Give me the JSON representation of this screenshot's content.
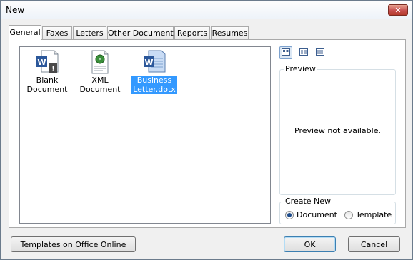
{
  "window": {
    "title": "New",
    "close_symbol": "✕"
  },
  "tabs": [
    {
      "label": "General",
      "active": true
    },
    {
      "label": "Faxes"
    },
    {
      "label": "Letters"
    },
    {
      "label": "Other Documents"
    },
    {
      "label": "Reports"
    },
    {
      "label": "Resumes"
    }
  ],
  "files": [
    {
      "label_lines": [
        "Blank",
        "Document"
      ],
      "icon": "word-blank-document-icon"
    },
    {
      "label_lines": [
        "XML Document"
      ],
      "icon": "xml-document-icon"
    },
    {
      "label_lines": [
        "Business",
        "Letter.dotx"
      ],
      "icon": "word-template-icon",
      "selected": true
    }
  ],
  "view_buttons": [
    {
      "name": "large-icons-view",
      "active": true
    },
    {
      "name": "list-view"
    },
    {
      "name": "details-view"
    }
  ],
  "preview": {
    "label": "Preview",
    "message": "Preview not available."
  },
  "create_new": {
    "label": "Create New",
    "document_label": "Document",
    "template_label": "Template",
    "selected": "Document"
  },
  "buttons": {
    "templates_online": "Templates on Office Online",
    "ok": "OK",
    "cancel": "Cancel"
  },
  "colors": {
    "selection": "#3399ff",
    "word_blue": "#2b579a",
    "title_close": "#c75050"
  }
}
